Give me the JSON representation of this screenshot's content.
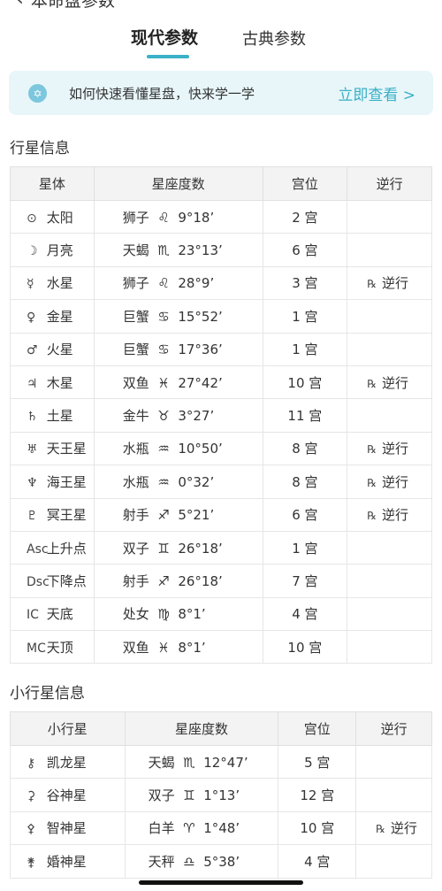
{
  "header": {
    "back_icon": "chevron-left-icon",
    "title": "本命盘参数"
  },
  "tabs": [
    {
      "label": "现代参数",
      "active": true
    },
    {
      "label": "古典参数",
      "active": false
    }
  ],
  "banner": {
    "icon": "star-of-david-icon",
    "text": "如何快速看懂星盘，快来学一学",
    "link": "立即查看 >"
  },
  "planet_section": {
    "title": "行星信息",
    "headers": [
      "星体",
      "星座度数",
      "宫位",
      "逆行"
    ],
    "rows": [
      {
        "sym": "⊙",
        "name": "太阳",
        "sign": "狮子",
        "sign_sym": "♌",
        "degree": "9°18’",
        "house": "2 宫",
        "retro": "",
        "teal": true
      },
      {
        "sym": "☽",
        "name": "月亮",
        "sign": "天蝎",
        "sign_sym": "♏",
        "degree": "23°13’",
        "house": "6 宫",
        "retro": "",
        "teal": true
      },
      {
        "sym": "☿",
        "name": "水星",
        "sign": "狮子",
        "sign_sym": "♌",
        "degree": "28°9’",
        "house": "3 宫",
        "retro": "逆行",
        "teal": true
      },
      {
        "sym": "♀",
        "name": "金星",
        "sign": "巨蟹",
        "sign_sym": "♋",
        "degree": "15°52’",
        "house": "1 宫",
        "retro": "",
        "teal": true
      },
      {
        "sym": "♂",
        "name": "火星",
        "sign": "巨蟹",
        "sign_sym": "♋",
        "degree": "17°36’",
        "house": "1 宫",
        "retro": "",
        "teal": true
      },
      {
        "sym": "♃",
        "name": "木星",
        "sign": "双鱼",
        "sign_sym": "♓",
        "degree": "27°42’",
        "house": "10 宫",
        "retro": "逆行",
        "teal": true
      },
      {
        "sym": "♄",
        "name": "土星",
        "sign": "金牛",
        "sign_sym": "♉",
        "degree": "3°27’",
        "house": "11 宫",
        "retro": "",
        "teal": true
      },
      {
        "sym": "♅",
        "name": "天王星",
        "sign": "水瓶",
        "sign_sym": "♒",
        "degree": "10°50’",
        "house": "8 宫",
        "retro": "逆行",
        "teal": true
      },
      {
        "sym": "♆",
        "name": "海王星",
        "sign": "水瓶",
        "sign_sym": "♒",
        "degree": "0°32’",
        "house": "8 宫",
        "retro": "逆行",
        "teal": true
      },
      {
        "sym": "♇",
        "name": "冥王星",
        "sign": "射手",
        "sign_sym": "♐",
        "degree": "5°21’",
        "house": "6 宫",
        "retro": "逆行",
        "teal": true
      },
      {
        "sym": "Asc",
        "name": "上升点",
        "sign": "双子",
        "sign_sym": "♊",
        "degree": "26°18’",
        "house": "1 宫",
        "retro": "",
        "teal": true
      },
      {
        "sym": "Dsc",
        "name": "下降点",
        "sign": "射手",
        "sign_sym": "♐",
        "degree": "26°18’",
        "house": "7 宫",
        "retro": "",
        "teal": false
      },
      {
        "sym": "IC",
        "name": "天底",
        "sign": "处女",
        "sign_sym": "♍",
        "degree": "8°1’",
        "house": "4 宫",
        "retro": "",
        "teal": false
      },
      {
        "sym": "MC",
        "name": "天顶",
        "sign": "双鱼",
        "sign_sym": "♓",
        "degree": "8°1’",
        "house": "10 宫",
        "retro": "",
        "teal": true
      }
    ]
  },
  "asteroid_section": {
    "title": "小行星信息",
    "headers": [
      "小行星",
      "星座度数",
      "宫位",
      "逆行"
    ],
    "rows": [
      {
        "sym": "⚷",
        "name": "凯龙星",
        "sign": "天蝎",
        "sign_sym": "♏",
        "degree": "12°47’",
        "house": "5 宫",
        "retro": "",
        "teal": true
      },
      {
        "sym": "⚳",
        "name": "谷神星",
        "sign": "双子",
        "sign_sym": "♊",
        "degree": "1°13’",
        "house": "12 宫",
        "retro": "",
        "teal": true
      },
      {
        "sym": "⚴",
        "name": "智神星",
        "sign": "白羊",
        "sign_sym": "♈",
        "degree": "1°48’",
        "house": "10 宫",
        "retro": "逆行",
        "teal": true
      },
      {
        "sym": "⚵",
        "name": "婚神星",
        "sign": "天秤",
        "sign_sym": "♎",
        "degree": "5°38’",
        "house": "4 宫",
        "retro": "",
        "teal": true
      }
    ]
  },
  "retro_symbol": "℞",
  "colors": {
    "accent": "#39a9bf",
    "banner_bg": "#e8f6fa",
    "header_bg": "#f3f3f3"
  }
}
